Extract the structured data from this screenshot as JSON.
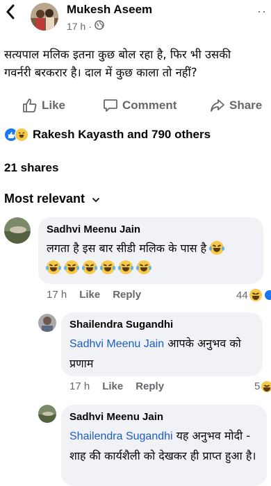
{
  "post": {
    "author": "Mukesh Aseem",
    "time": "17 h",
    "separator": "·",
    "text": "सत्यपाल मलिक इतना कुछ बोल रहा है, फिर भी उसकी गवर्नरी बरकरार है। दाल में कुछ काला तो नहीं?",
    "more": "··"
  },
  "actions": {
    "like": "Like",
    "comment": "Comment",
    "share": "Share"
  },
  "reactions": {
    "summary": "Rakesh Kayasth and 790 others"
  },
  "shares": "21 shares",
  "sort": {
    "label": "Most relevant"
  },
  "comments": [
    {
      "name": "Sadhvi Meenu Jain",
      "text": "लगता है इस बार सीडी मलिक के पास है",
      "time": "17 h",
      "like": "Like",
      "reply": "Reply",
      "count": "44"
    },
    {
      "name": "Shailendra Sugandhi",
      "mention": "Sadhvi Meenu Jain",
      "text": "आपके अनुभव को प्रणाम",
      "time": "17 h",
      "like": "Like",
      "reply": "Reply",
      "count": "5"
    },
    {
      "name": "Sadhvi Meenu Jain",
      "mention": "Shailendra Sugandhi",
      "text": "यह अनुभव मोदी - शाह की कार्यशैली को देखकर ही प्राप्त हुआ है।"
    }
  ],
  "colors": {
    "like_blue": "#1877f2",
    "mention": "#1b5cc8",
    "muted": "#65676b",
    "bubble": "#f0f2f5"
  }
}
